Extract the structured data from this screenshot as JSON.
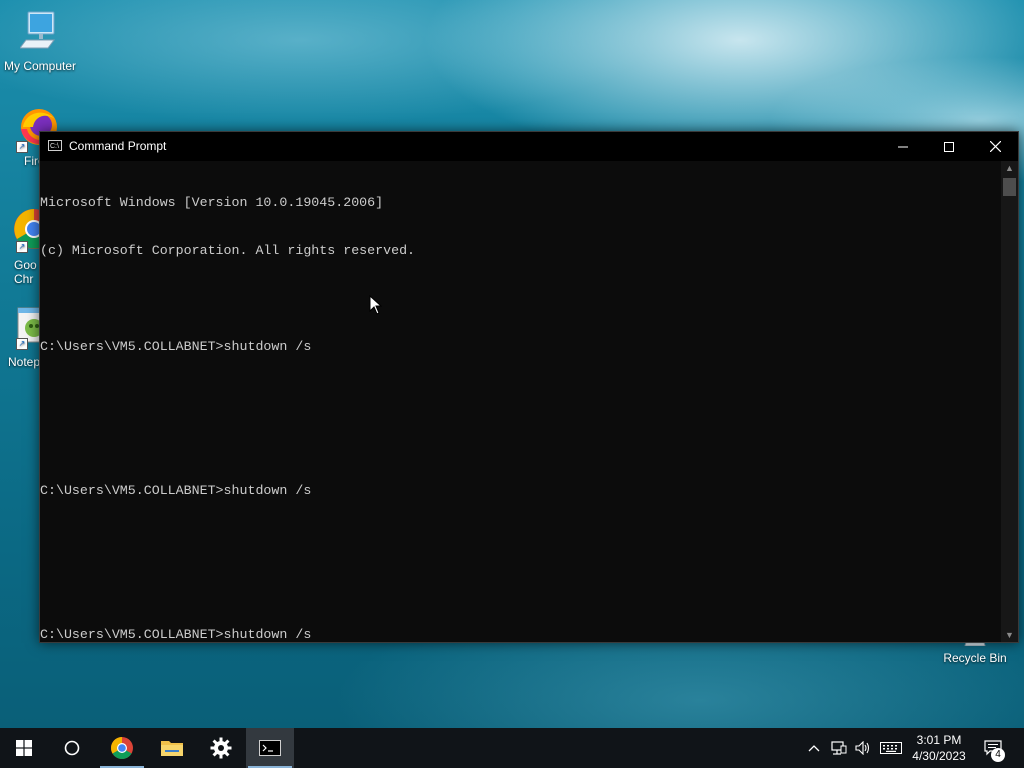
{
  "desktop": {
    "icons": [
      {
        "label": "My Computer",
        "icon": "computer-icon"
      },
      {
        "label": "Fire",
        "icon": "firefox-icon"
      },
      {
        "label": "Goo\nChr",
        "icon": "chrome-icon"
      },
      {
        "label": "Notep",
        "icon": "notepad-icon"
      },
      {
        "label": "Recycle Bin",
        "icon": "recycle-bin-icon"
      }
    ]
  },
  "window": {
    "title": "Command Prompt",
    "buttons": {
      "minimize": "minimize-icon",
      "maximize": "maximize-icon",
      "close": "close-icon"
    },
    "console_lines": [
      "Microsoft Windows [Version 10.0.19045.2006]",
      "(c) Microsoft Corporation. All rights reserved.",
      "",
      "C:\\Users\\VM5.COLLABNET>shutdown /s",
      "",
      "",
      "C:\\Users\\VM5.COLLABNET>shutdown /s",
      "",
      "",
      "C:\\Users\\VM5.COLLABNET>shutdown /s"
    ]
  },
  "taskbar": {
    "items": [
      {
        "name": "start-button",
        "icon": "windows-icon"
      },
      {
        "name": "search-button",
        "icon": "cortana-circle-icon"
      },
      {
        "name": "taskbar-chrome",
        "icon": "chrome-icon"
      },
      {
        "name": "taskbar-file-explorer",
        "icon": "folder-icon"
      },
      {
        "name": "taskbar-settings",
        "icon": "gear-icon"
      },
      {
        "name": "taskbar-command-prompt",
        "icon": "cmd-icon",
        "active": true
      }
    ],
    "tray": {
      "clock_time": "3:01 PM",
      "clock_date": "4/30/2023",
      "notification_count": "4"
    }
  },
  "colors": {
    "console_bg": "#0c0c0c",
    "console_text": "#cccccc",
    "taskbar_bg": "#101418",
    "active_indicator": "#8ab4d8"
  }
}
